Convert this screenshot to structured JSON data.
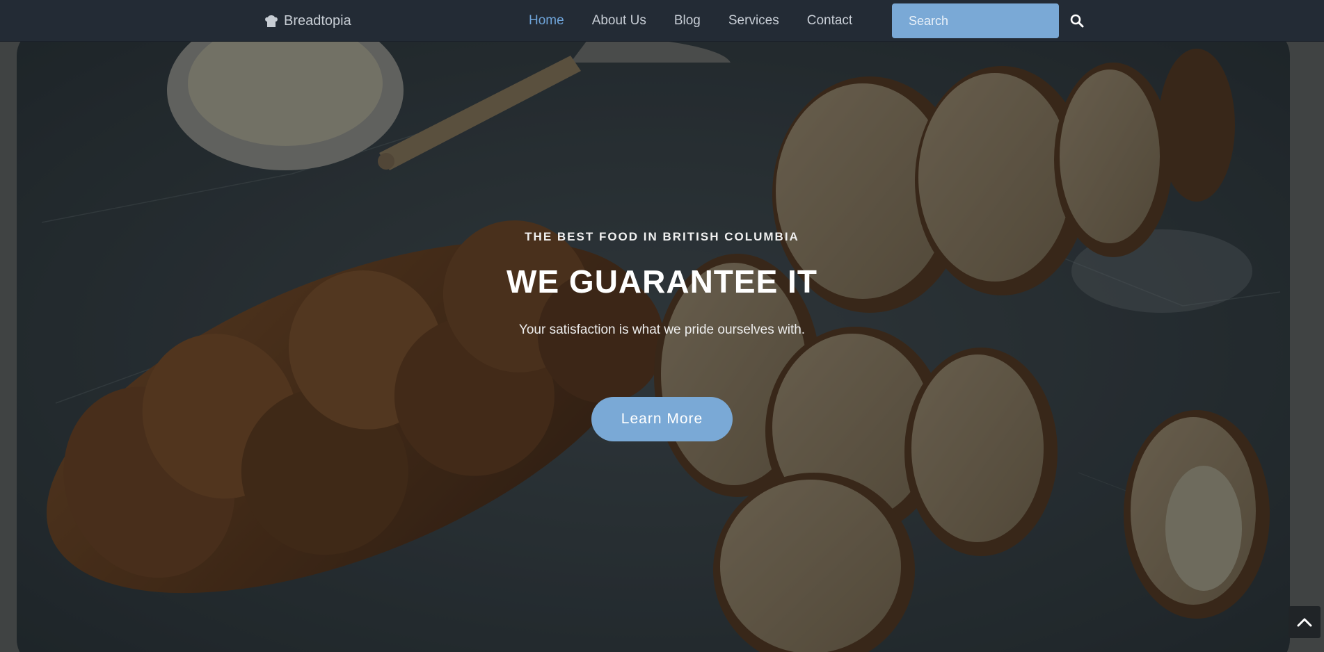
{
  "nav": {
    "brand": "Breadtopia",
    "brand_icon": "chef-hat-icon",
    "links": [
      {
        "label": "Home",
        "active": true
      },
      {
        "label": "About Us",
        "active": false
      },
      {
        "label": "Blog",
        "active": false
      },
      {
        "label": "Services",
        "active": false
      },
      {
        "label": "Contact",
        "active": false
      }
    ],
    "search_placeholder": "Search",
    "search_icon": "search-icon"
  },
  "hero": {
    "kicker": "THE BEST FOOD IN BRITISH COLUMBIA",
    "headline": "WE GUARANTEE IT",
    "subtitle": "Your satisfaction is what we pride ourselves with.",
    "cta": "Learn More",
    "background_image": "braided-bread-on-marble-board"
  },
  "back_to_top_icon": "chevron-up-icon",
  "colors": {
    "navbar": "#232b35",
    "accent": "#7aa9d6",
    "active_link": "#6ea3d8"
  }
}
